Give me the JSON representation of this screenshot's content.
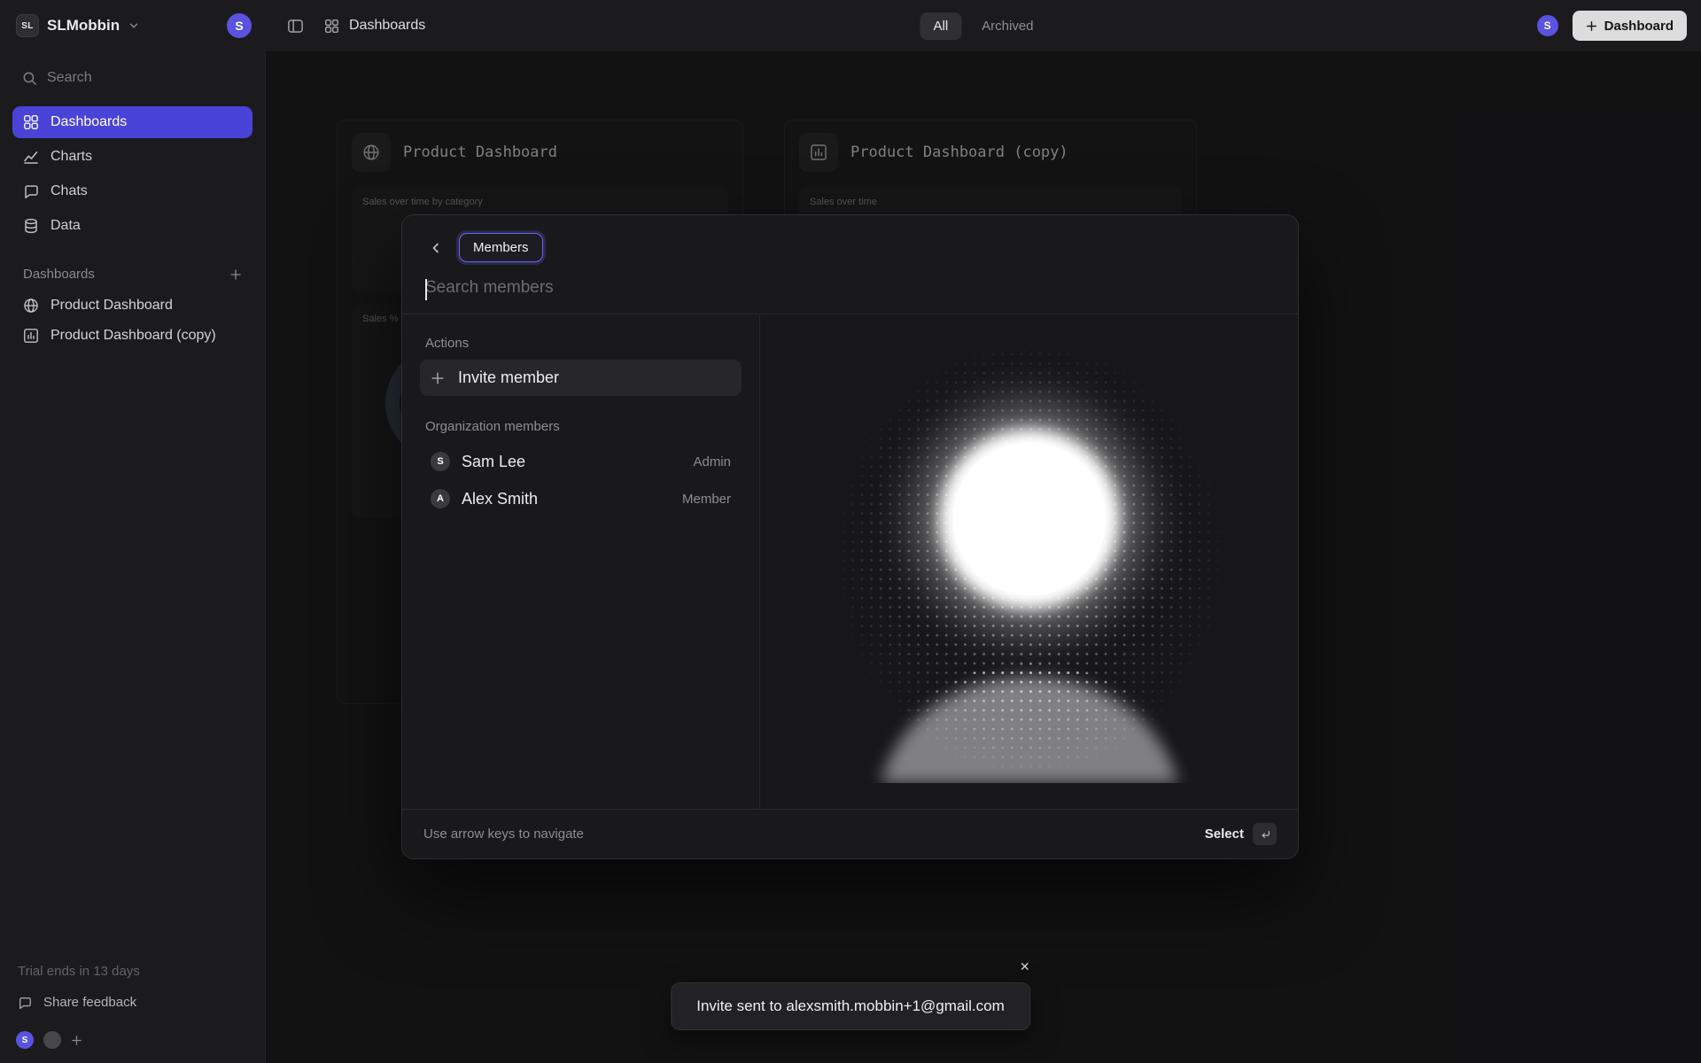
{
  "colors": {
    "accent_indigo": "#4a43d8",
    "avatar_indigo": "#5a52e0",
    "focus_ring": "#6d66f2",
    "new_button_bg": "#dcdcdc"
  },
  "topbar": {
    "workspace_initials": "SL",
    "workspace_name": "SLMobbin",
    "workspace_avatar_letter": "S",
    "breadcrumb": "Dashboards",
    "tab_all": "All",
    "tab_archived": "Archived",
    "user_avatar_letter": "S",
    "new_dashboard_button": "Dashboard"
  },
  "sidebar": {
    "search_placeholder": "Search",
    "nav": [
      {
        "label": "Dashboards",
        "icon": "grid-icon"
      },
      {
        "label": "Charts",
        "icon": "chart-line-icon"
      },
      {
        "label": "Chats",
        "icon": "chat-bubble-icon"
      },
      {
        "label": "Data",
        "icon": "database-icon"
      }
    ],
    "section_title": "Dashboards",
    "items": [
      {
        "label": "Product Dashboard",
        "icon": "globe-icon"
      },
      {
        "label": "Product Dashboard (copy)",
        "icon": "bar-chart-icon"
      }
    ],
    "trial_note": "Trial ends in 13 days",
    "share_feedback": "Share feedback",
    "footer_avatar_letter": "S"
  },
  "main": {
    "cards": [
      {
        "title": "Product Dashboard",
        "icon": "globe-icon",
        "chart_labels": [
          "Sales over time by category",
          "Sales % by"
        ]
      },
      {
        "title": "Product Dashboard (copy)",
        "icon": "bar-chart-icon",
        "chart_labels": [
          "Sales over time"
        ]
      }
    ]
  },
  "modal": {
    "badge": "Members",
    "search_placeholder": "Search members",
    "actions_title": "Actions",
    "invite_member_label": "Invite member",
    "members_title": "Organization members",
    "members": [
      {
        "avatar_letter": "S",
        "name": "Sam Lee",
        "role": "Admin"
      },
      {
        "avatar_letter": "A",
        "name": "Alex Smith",
        "role": "Member"
      }
    ],
    "footer_hint": "Use arrow keys to navigate",
    "footer_select_label": "Select"
  },
  "toast": {
    "message": "Invite sent to alexsmith.mobbin+1@gmail.com",
    "close_label": "✕"
  }
}
